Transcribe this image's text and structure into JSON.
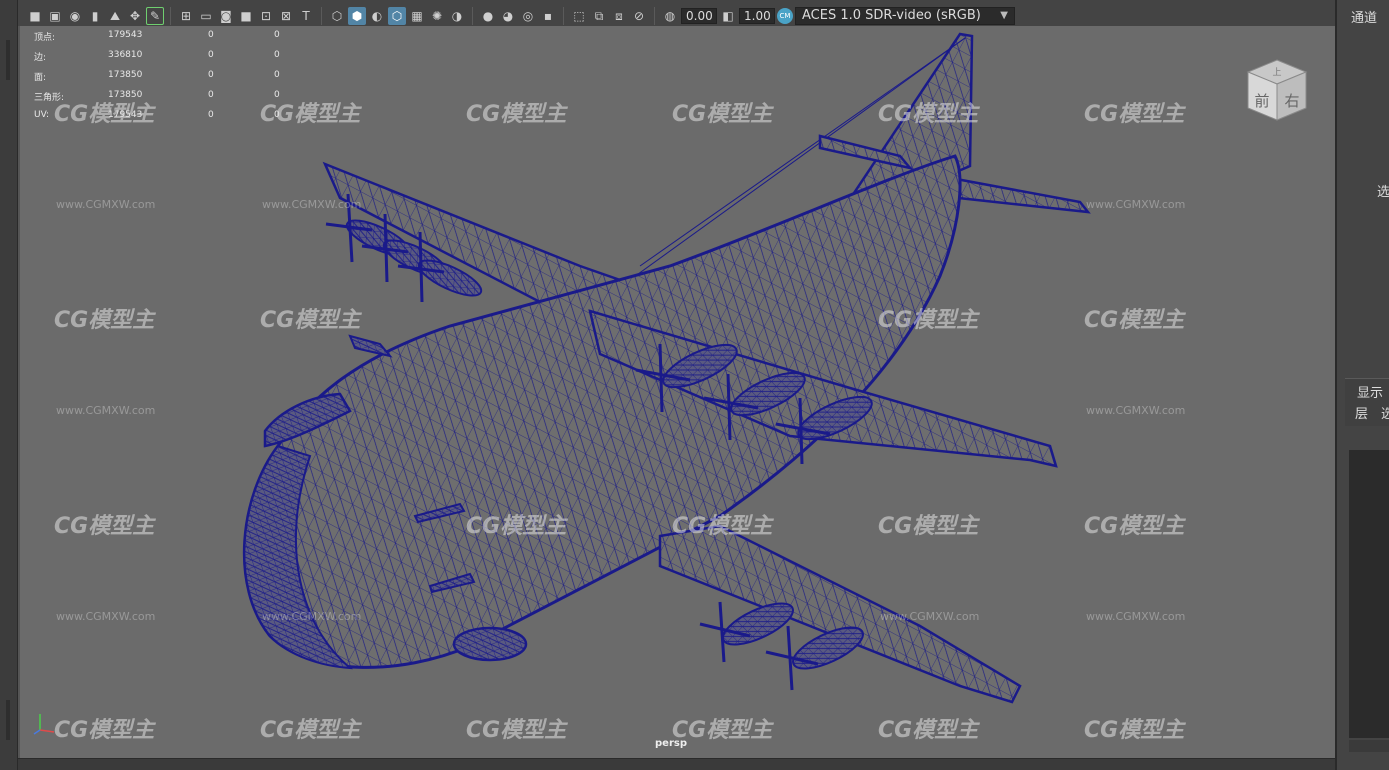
{
  "toolbar": {
    "exposure_value": "0.00",
    "gamma_value": "1.00",
    "color_space": "ACES 1.0 SDR-video (sRGB)"
  },
  "hud": {
    "rows": [
      {
        "label": "顶点:",
        "v1": "179543",
        "v2": "0",
        "v3": "0"
      },
      {
        "label": "边:",
        "v1": "336810",
        "v2": "0",
        "v3": "0"
      },
      {
        "label": "面:",
        "v1": "173850",
        "v2": "0",
        "v3": "0"
      },
      {
        "label": "三角形:",
        "v1": "173850",
        "v2": "0",
        "v3": "0"
      },
      {
        "label": "UV:",
        "v1": "179543",
        "v2": "0",
        "v3": "0"
      }
    ]
  },
  "viewport": {
    "camera_label": "persp",
    "viewcube": {
      "front": "前",
      "right": "右",
      "top": "上"
    }
  },
  "watermark": {
    "logo_text": "CG模型主",
    "url_text": "www.CGMXW.com"
  },
  "right_panel": {
    "channel_tab": "通道",
    "side_text_1": "选",
    "display_tab": "显示",
    "layer_label": "层",
    "layer_option": "选"
  },
  "colors": {
    "viewport_bg": "#6b6b6b",
    "wireframe": "#1a1a8a",
    "ui_bg": "#444444",
    "accent": "#5285a6"
  }
}
